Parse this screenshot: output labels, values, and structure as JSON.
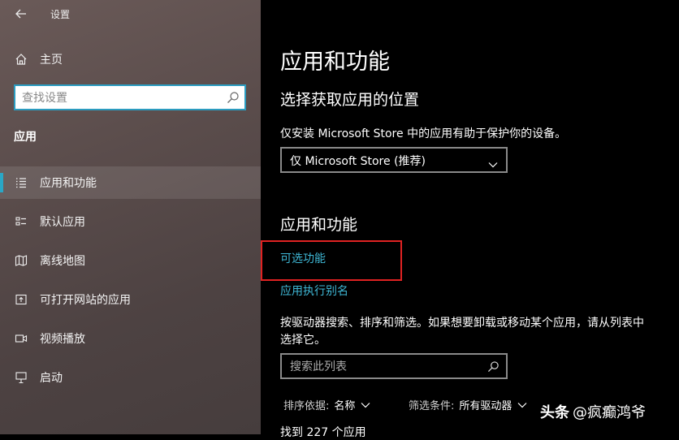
{
  "window": {
    "title": "设置"
  },
  "sidebar": {
    "home_label": "主页",
    "search_placeholder": "查找设置",
    "section_header": "应用",
    "items": [
      {
        "label": "应用和功能",
        "icon": "list-icon",
        "selected": true
      },
      {
        "label": "默认应用",
        "icon": "default-apps-icon",
        "selected": false
      },
      {
        "label": "离线地图",
        "icon": "map-icon",
        "selected": false
      },
      {
        "label": "可打开网站的应用",
        "icon": "open-website-icon",
        "selected": false
      },
      {
        "label": "视频播放",
        "icon": "video-icon",
        "selected": false
      },
      {
        "label": "启动",
        "icon": "startup-icon",
        "selected": false
      }
    ]
  },
  "main": {
    "title": "应用和功能",
    "install_section": {
      "heading": "选择获取应用的位置",
      "description": "仅安装 Microsoft Store 中的应用有助于保护你的设备。",
      "dropdown_value": "仅 Microsoft Store (推荐)"
    },
    "apps_section": {
      "heading": "应用和功能",
      "link_optional_features": "可选功能",
      "link_app_aliases": "应用执行别名",
      "description": "按驱动器搜索、排序和筛选。如果想要卸载或移动某个应用，请从列表中选择它。",
      "search_placeholder": "搜索此列表",
      "sort_label": "排序依据:",
      "sort_value": "名称",
      "filter_label": "筛选条件:",
      "filter_value": "所有驱动器",
      "count_text": "找到 227 个应用"
    }
  },
  "watermark": {
    "brand": "头条",
    "handle": "@疯癫鸿爷"
  },
  "colors": {
    "accent": "#2aa7c6",
    "link": "#3fb8d6",
    "highlight": "#e02222"
  }
}
